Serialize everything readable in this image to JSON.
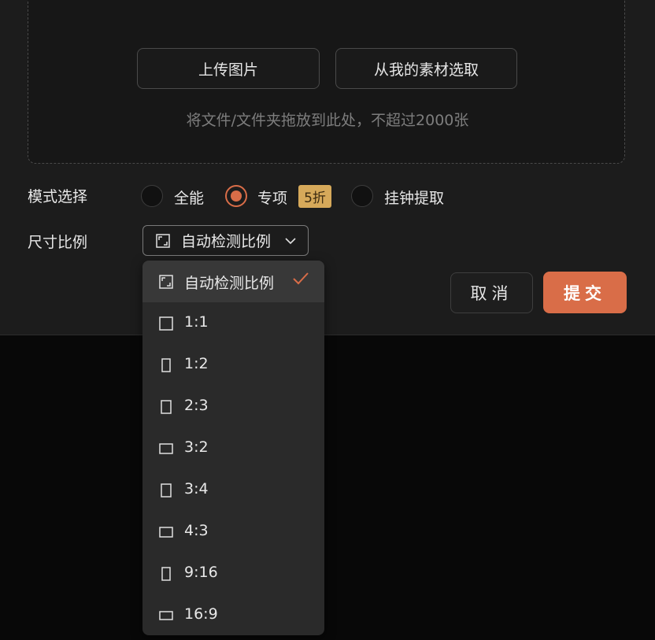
{
  "upload": {
    "upload_button": "上传图片",
    "library_button": "从我的素材选取",
    "hint": "将文件/文件夹拖放到此处，不超过2000张"
  },
  "mode": {
    "label": "模式选择",
    "options": [
      "全能",
      "专项",
      "挂钟提取"
    ],
    "selected": "专项",
    "badge": "5折"
  },
  "size": {
    "label": "尺寸比例",
    "selected": "自动检测比例",
    "options": [
      {
        "label": "自动检测比例",
        "icon": "auto-ratio-icon"
      },
      {
        "label": "1:1",
        "icon": "square-icon"
      },
      {
        "label": "1:2",
        "icon": "portrait-icon"
      },
      {
        "label": "2:3",
        "icon": "portrait-icon"
      },
      {
        "label": "3:2",
        "icon": "landscape-icon"
      },
      {
        "label": "3:4",
        "icon": "portrait-icon"
      },
      {
        "label": "4:3",
        "icon": "landscape-icon"
      },
      {
        "label": "9:16",
        "icon": "portrait-icon"
      },
      {
        "label": "16:9",
        "icon": "landscape-icon"
      }
    ]
  },
  "actions": {
    "cancel": "取消",
    "submit": "提交"
  },
  "colors": {
    "accent": "#d96d48",
    "badge": "#d6a95a",
    "panel": "#1c1c1c",
    "background": "#080808"
  }
}
